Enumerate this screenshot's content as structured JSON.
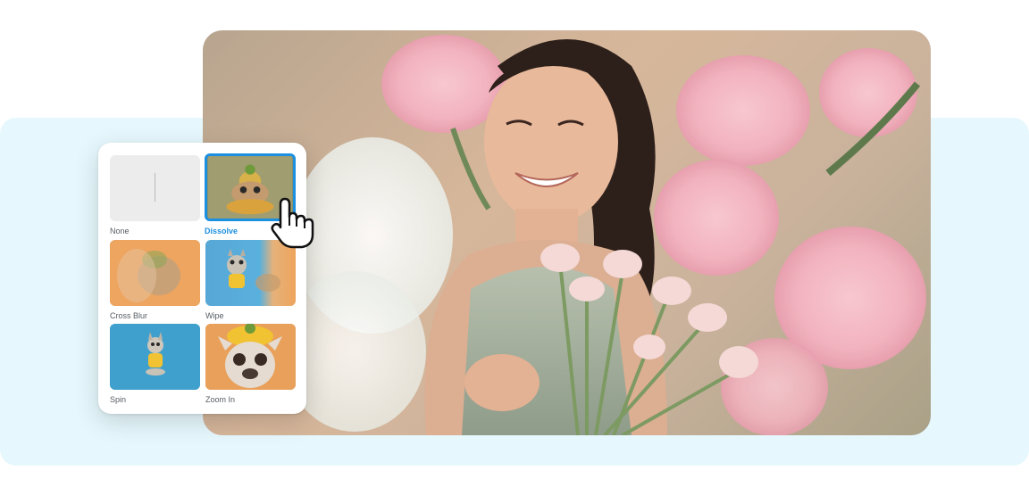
{
  "transitions": {
    "items": [
      {
        "label": "None",
        "selected": false,
        "icon": "none-thumbnail"
      },
      {
        "label": "Dissolve",
        "selected": true,
        "icon": "dog-in-pineapple-hat-thumbnail"
      },
      {
        "label": "Cross Blur",
        "selected": false,
        "icon": "blurred-dog-thumbnail"
      },
      {
        "label": "Wipe",
        "selected": false,
        "icon": "dog-wipe-thumbnail"
      },
      {
        "label": "Spin",
        "selected": false,
        "icon": "dog-blue-background-thumbnail"
      },
      {
        "label": "Zoom In",
        "selected": false,
        "icon": "dog-closeup-thumbnail"
      }
    ]
  },
  "colors": {
    "accent": "#1b8fe0",
    "backdrop": "#e6f8fd"
  },
  "cursor": {
    "icon": "hand-pointer-icon"
  }
}
